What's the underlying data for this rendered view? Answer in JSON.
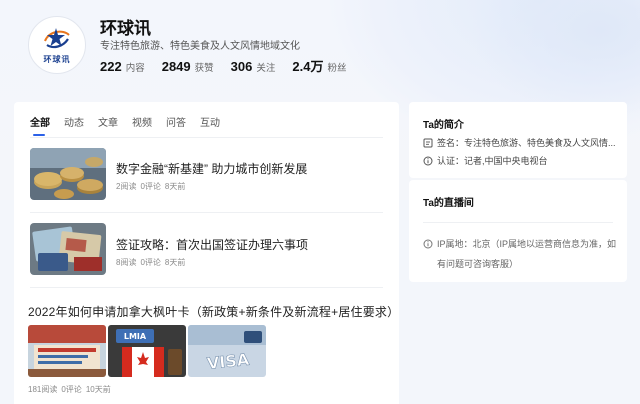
{
  "profile": {
    "name": "环球讯",
    "description": "专注特色旅游、特色美食及人文风情地域文化",
    "logo_text": "环球讯",
    "stats": [
      {
        "num": "222",
        "label": "内容"
      },
      {
        "num": "2849",
        "label": "获赞"
      },
      {
        "num": "306",
        "label": "关注"
      },
      {
        "num": "2.4万",
        "label": "粉丝"
      }
    ]
  },
  "tabs": [
    {
      "label": "全部",
      "active": true
    },
    {
      "label": "动态"
    },
    {
      "label": "文章"
    },
    {
      "label": "视频"
    },
    {
      "label": "问答"
    },
    {
      "label": "互动"
    }
  ],
  "articles": [
    {
      "title": "数字金融“新基建” 助力城市创新发展",
      "reads": "2阅读",
      "comments": "0评论",
      "time": "8天前"
    },
    {
      "title": "签证攻略：首次出国签证办理六事项",
      "reads": "8阅读",
      "comments": "0评论",
      "time": "8天前"
    },
    {
      "title": "2022年如何申请加拿大枫叶卡（新政策+新条件及新流程+居住要求）",
      "reads": "181阅读",
      "comments": "0评论",
      "time": "10天前",
      "img_text": "LMIA"
    }
  ],
  "sidebar": {
    "intro_title": "Ta的简介",
    "signature": "签名：专注特色旅游、特色美食及人文风情...",
    "certification": "认证：记者,中国中央电视台",
    "live_title": "Ta的直播间",
    "ip_line1": "IP属地：北京（IP属地以运营商信息为准，如",
    "ip_line2": "有问题可咨询客服）"
  }
}
